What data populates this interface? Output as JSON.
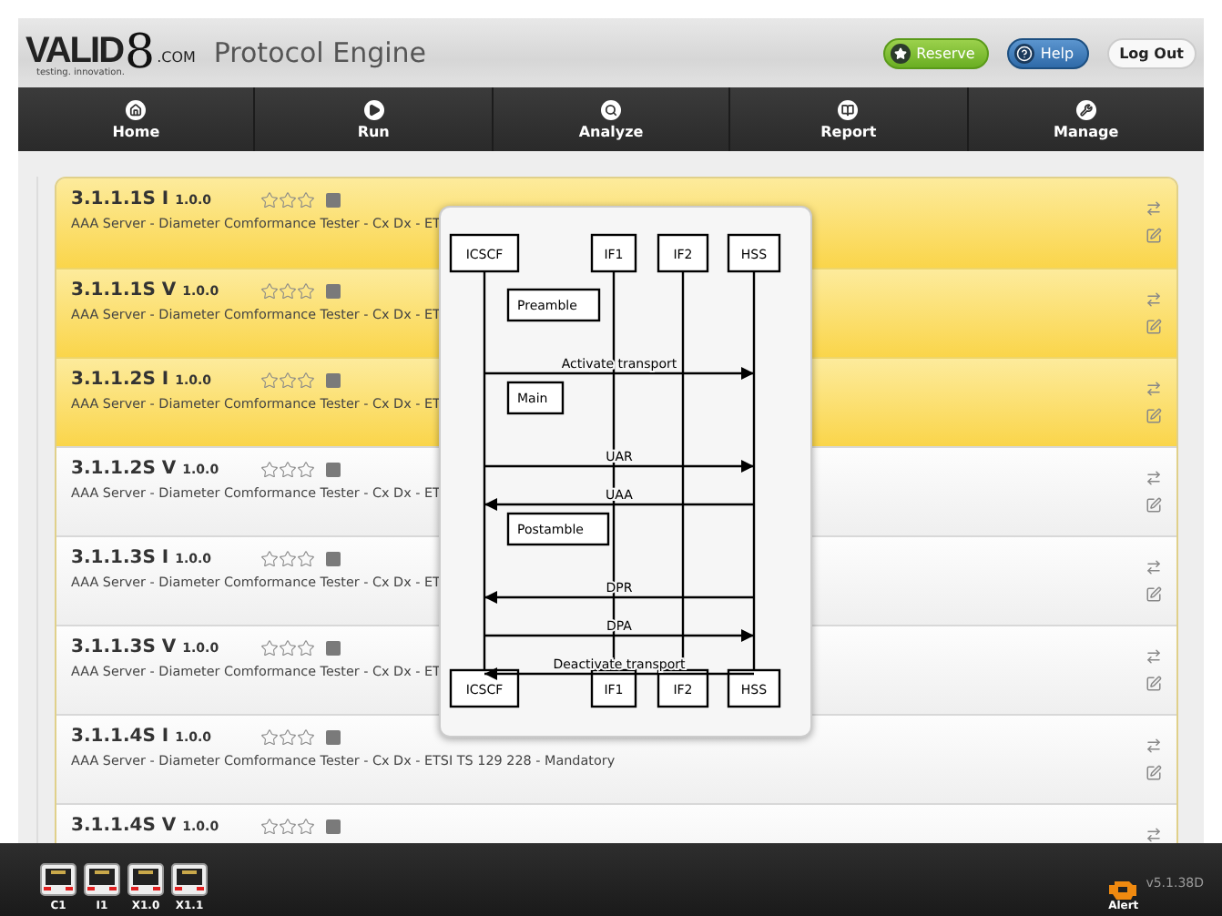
{
  "header": {
    "logo": {
      "letters": "VALID",
      "digit": "8",
      "suffix": ".COM",
      "tagline": "testing. innovation."
    },
    "title": "Protocol Engine",
    "buttons": [
      {
        "kind": "reserve",
        "label": "Reserve"
      },
      {
        "kind": "help",
        "label": "Help"
      },
      {
        "kind": "logout",
        "label": "Log Out"
      }
    ]
  },
  "nav": [
    {
      "kind": "home",
      "label": "Home"
    },
    {
      "kind": "run",
      "label": "Run"
    },
    {
      "kind": "analyze",
      "label": "Analyze"
    },
    {
      "kind": "report",
      "label": "Report"
    },
    {
      "kind": "manage",
      "label": "Manage"
    }
  ],
  "tests": [
    {
      "id": "3.1.1.1S I",
      "version": "1.0.0",
      "stars": 0,
      "selected": true,
      "description": "AAA Server - Diameter Comformance Tester - Cx Dx - ET"
    },
    {
      "id": "3.1.1.1S V",
      "version": "1.0.0",
      "stars": 0,
      "selected": true,
      "description": "AAA Server - Diameter Comformance Tester - Cx Dx - ET"
    },
    {
      "id": "3.1.1.2S I",
      "version": "1.0.0",
      "stars": 0,
      "selected": true,
      "description": "AAA Server - Diameter Comformance Tester - Cx Dx - ET"
    },
    {
      "id": "3.1.1.2S V",
      "version": "1.0.0",
      "stars": 0,
      "selected": false,
      "description": "AAA Server - Diameter Comformance Tester - Cx Dx - ET"
    },
    {
      "id": "3.1.1.3S I",
      "version": "1.0.0",
      "stars": 0,
      "selected": false,
      "description": "AAA Server - Diameter Comformance Tester - Cx Dx - ET"
    },
    {
      "id": "3.1.1.3S V",
      "version": "1.0.0",
      "stars": 0,
      "selected": false,
      "description": "AAA Server - Diameter Comformance Tester - Cx Dx - ET"
    },
    {
      "id": "3.1.1.4S I",
      "version": "1.0.0",
      "stars": 0,
      "selected": false,
      "description": "AAA Server - Diameter Comformance Tester - Cx Dx - ETSI TS 129 228 - Mandatory"
    },
    {
      "id": "3.1.1.4S V",
      "version": "1.0.0",
      "stars": 0,
      "selected": false
    }
  ],
  "sequence_popup": {
    "top_participants": [
      "ICSCF",
      "IF1",
      "IF2",
      "HSS"
    ],
    "bottom_participants": [
      "ICSCF",
      "IF1",
      "IF2",
      "HSS"
    ],
    "steps": [
      {
        "kind": "section",
        "label": "Preamble"
      },
      {
        "kind": "message_right",
        "label": "Activate transport"
      },
      {
        "kind": "section",
        "label": "Main"
      },
      {
        "kind": "message_right",
        "label": "UAR"
      },
      {
        "kind": "message_left",
        "label": "UAA"
      },
      {
        "kind": "section",
        "label": "Postamble"
      },
      {
        "kind": "message_left",
        "label": "DPR"
      },
      {
        "kind": "message_right",
        "label": "DPA"
      },
      {
        "kind": "message_left",
        "label": "Deactivate transport"
      }
    ]
  },
  "footer": {
    "ports": [
      "C1",
      "I1",
      "X1.0",
      "X1.1"
    ],
    "alert": "Alert",
    "version": "v5.1.38D"
  }
}
